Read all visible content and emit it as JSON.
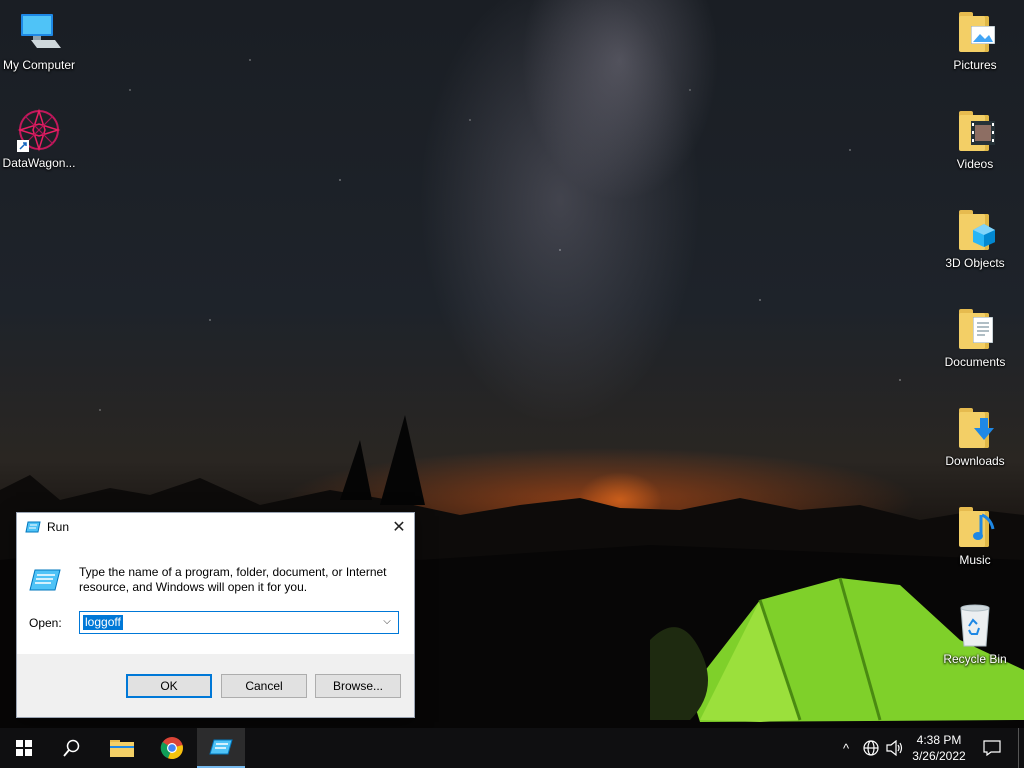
{
  "desktop": {
    "left_icons": [
      {
        "label": "My Computer",
        "icon": "computer-icon"
      },
      {
        "label": "DataWagon...",
        "icon": "datawagon-shortcut-icon"
      }
    ],
    "right_icons": [
      {
        "label": "Pictures",
        "icon": "pictures-folder-icon"
      },
      {
        "label": "Videos",
        "icon": "videos-folder-icon"
      },
      {
        "label": "3D Objects",
        "icon": "3d-objects-folder-icon"
      },
      {
        "label": "Documents",
        "icon": "documents-folder-icon"
      },
      {
        "label": "Downloads",
        "icon": "downloads-folder-icon"
      },
      {
        "label": "Music",
        "icon": "music-folder-icon"
      },
      {
        "label": "Recycle Bin",
        "icon": "recycle-bin-icon"
      }
    ]
  },
  "run_dialog": {
    "title": "Run",
    "close_glyph": "✕",
    "description": "Type the name of a program, folder, document, or Internet resource, and Windows will open it for you.",
    "open_label": "Open:",
    "open_value": "loggoff",
    "dropdown_glyph": "⌵",
    "ok_label": "OK",
    "cancel_label": "Cancel",
    "browse_label": "Browse..."
  },
  "taskbar": {
    "buttons": [
      {
        "name": "start",
        "icon": "windows-logo-icon"
      },
      {
        "name": "search",
        "icon": "search-icon"
      },
      {
        "name": "file-explorer",
        "icon": "folder-icon"
      },
      {
        "name": "chrome",
        "icon": "chrome-icon"
      },
      {
        "name": "run",
        "icon": "run-app-icon",
        "active": true
      }
    ],
    "tray": {
      "chevron": "^",
      "time": "4:38 PM",
      "date": "3/26/2022"
    },
    "accent": "#76b9ed"
  }
}
